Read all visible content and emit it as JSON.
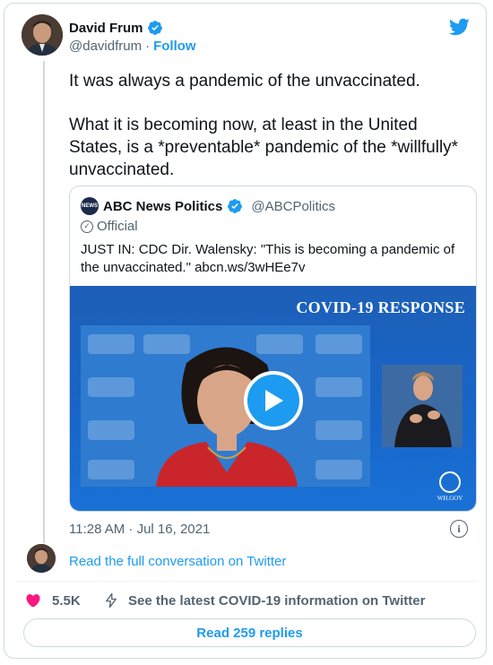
{
  "author": {
    "name": "David Frum",
    "handle": "@davidfrum",
    "separator": "·",
    "follow_label": "Follow"
  },
  "tweet": {
    "paragraphs": [
      "It was always a pandemic of the unvaccinated.",
      "What it is becoming now, at least in the United States, is a *preventable* pandemic of the *willfully* unvaccinated."
    ],
    "timestamp": "11:28 AM · Jul 16, 2021"
  },
  "quote": {
    "logo_text": "NEWS",
    "name": "ABC News Politics",
    "handle": "@ABCPolitics",
    "official_label": "Official",
    "text": "JUST IN: CDC Dir. Walensky: \"This is becoming a pandemic of the unvaccinated.\" abcn.ws/3wHEe7v",
    "video": {
      "overlay_title": "COVID-19 RESPONSE",
      "wh_label": "WH.GOV"
    }
  },
  "conversation_link": "Read the full conversation on Twitter",
  "actions": {
    "likes": "5.5K",
    "covid_info": "See the latest COVID-19 information on Twitter",
    "replies_button": "Read 259 replies"
  },
  "colors": {
    "accent": "#1d9bf0",
    "like": "#f91880",
    "text": "#0f1419",
    "muted": "#536471",
    "border": "#cfd9de"
  },
  "icons": [
    "verified-badge-icon",
    "twitter-bird-icon",
    "official-check-icon",
    "play-icon",
    "info-icon",
    "heart-icon",
    "lightning-icon"
  ]
}
